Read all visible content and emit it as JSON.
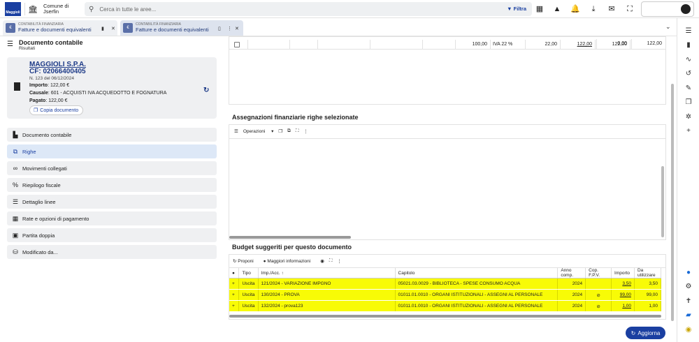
{
  "header": {
    "comune_line1": "Comune di",
    "comune_line2": "Jserfin",
    "search_placeholder": "Cerca in tutte le aree...",
    "filtra_label": "Filtra"
  },
  "tabs": [
    {
      "sub": "CONTABILITÀ FINANZIARIA",
      "label": "Fatture e documenti equivalenti",
      "badge": "€"
    },
    {
      "sub": "CONTABILITÀ FINANZIARIA",
      "label": "Fatture e documenti equivalenti",
      "badge": "€"
    }
  ],
  "left": {
    "title": "Documento contabile",
    "subtitle": "Risultati",
    "card": {
      "name": "MAGGIOLI S.P.A.",
      "cf": "CF: 02066400405",
      "number": "N. 123 del 06/12/2024",
      "importo_label": "Importo",
      "importo_value": ": 122,00 €",
      "causale_label": "Causale",
      "causale_value": ": 601 - ACQUISTI IVA ACQUEDOTTO E FOGNATURA",
      "pagato_label": "Pagato",
      "pagato_value": ": 122,00 €",
      "copy_label": "Copia documento"
    },
    "menu": [
      {
        "label": "Documento contabile",
        "icon": "document-icon"
      },
      {
        "label": "Righe",
        "icon": "rows-icon"
      },
      {
        "label": "Movimenti collegati",
        "icon": "link-icon"
      },
      {
        "label": "Riepilogo fiscale",
        "icon": "percent-icon"
      },
      {
        "label": "Dettaglio linee",
        "icon": "list-icon"
      },
      {
        "label": "Rate e opzioni di pagamento",
        "icon": "grid-icon"
      },
      {
        "label": "Partita doppia",
        "icon": "calendar-icon"
      },
      {
        "label": "Modificato da...",
        "icon": "history-icon"
      }
    ]
  },
  "righe_row": {
    "imponibile": "100,00",
    "iva": "IVA 22 %",
    "imposta": "22,00",
    "totale": "122,00",
    "totale2": "122,00",
    "zero": "0,00",
    "last": "122,00"
  },
  "assegnazioni": {
    "title": "Assegnazioni finanziarie righe selezionate",
    "operazioni": "Operazioni"
  },
  "budget": {
    "title": "Budget suggeriti per questo documento",
    "proponi": "Proponi",
    "maggiori": "Maggiori informazioni",
    "columns": [
      "Tipo",
      "Imp./Acc.",
      "Capitolo",
      "Anno comp.",
      "Cop. F.P.V.",
      "Importo",
      "Da utilizzare"
    ],
    "sort_arrow": "↑",
    "rows": [
      {
        "plus": "+",
        "tipo": "Uscita",
        "imp": "121/2024 - VARIAZIONE IMPGNO",
        "capitolo": "05021.03.0029 - BIBLIOTECA - SPESE CONSUMO ACQUA",
        "anno": "2024",
        "fpv": "",
        "importo": "3,50",
        "da_utilizzare": "3,50"
      },
      {
        "plus": "+",
        "tipo": "Uscita",
        "imp": "130/2024 - PROVA",
        "capitolo": "01011.01.0010 - ORGANI ISTITUZIONALI - ASSEGNI AL PERSONALE",
        "anno": "2024",
        "fpv": "⊘",
        "importo": "99,00",
        "da_utilizzare": "99,00"
      },
      {
        "plus": "+",
        "tipo": "Uscita",
        "imp": "132/2024 - prova123",
        "capitolo": "01011.01.0010 - ORGANI ISTITUZIONALI - ASSEGNI AL PERSONALE",
        "anno": "2024",
        "fpv": "⊘",
        "importo": "1,00",
        "da_utilizzare": "1,00"
      }
    ]
  },
  "footer": {
    "aggiorna": "Aggiorna"
  }
}
